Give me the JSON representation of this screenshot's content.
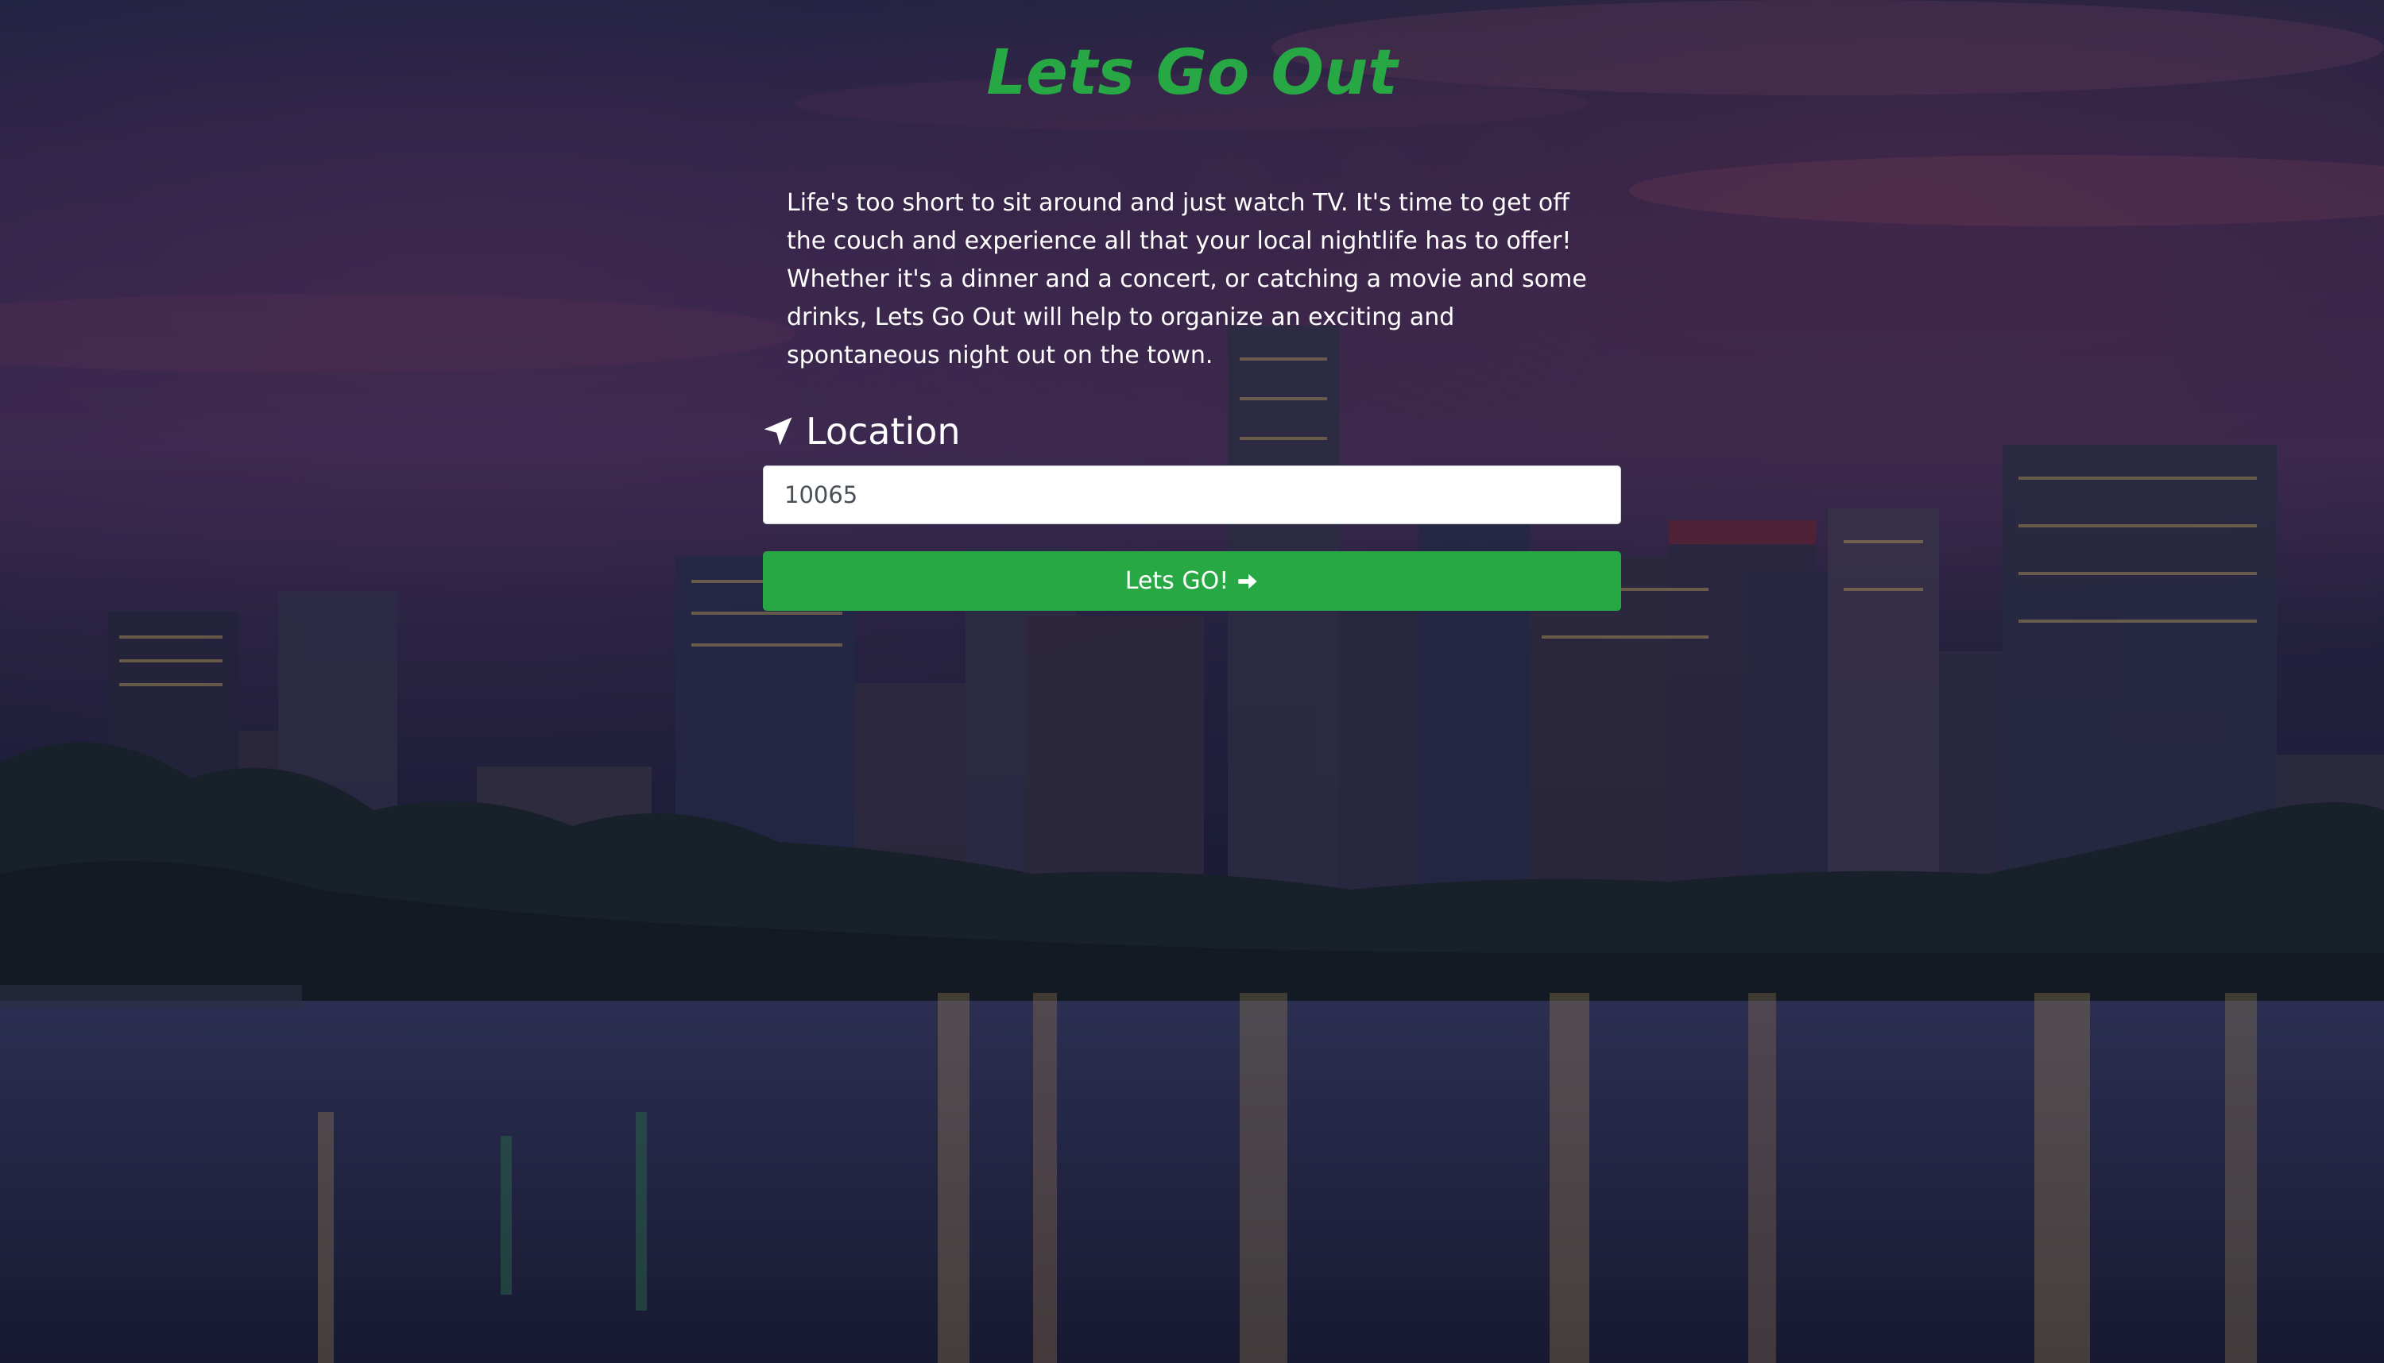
{
  "header": {
    "title": "Lets Go Out"
  },
  "intro": {
    "text": "Life's too short to sit around and just watch TV. It's time to get off the couch and experience all that your local nightlife has to offer! Whether it's a dinner and a concert, or catching a movie and some drinks, Lets Go Out will help to organize an exciting and spontaneous night out on the town."
  },
  "location": {
    "label": "Location",
    "icon": "location-arrow-icon",
    "input_value": "10065"
  },
  "action": {
    "button_label": "Lets GO!",
    "icon": "arrow-right-icon"
  },
  "colors": {
    "accent": "#28a745",
    "text": "#ffffff",
    "overlay": "#1a1d3a"
  }
}
